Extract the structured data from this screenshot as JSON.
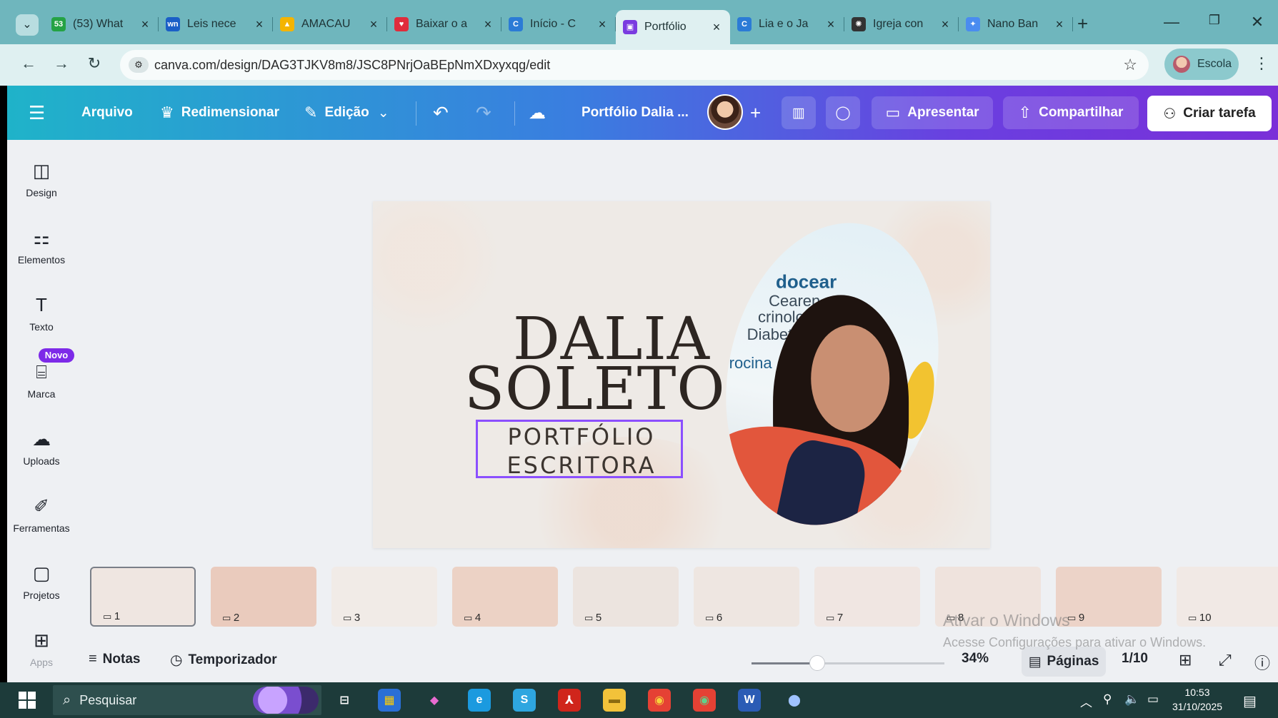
{
  "browser": {
    "tabs": [
      {
        "title": "(53) What",
        "favicon": "whatsapp-icon",
        "favicon_label": "53",
        "color": "#25a244"
      },
      {
        "title": "Leis nece",
        "favicon": "wn-icon",
        "favicon_label": "wn",
        "color": "#1a5fc7"
      },
      {
        "title": "AMACAU",
        "favicon": "google-drive-icon",
        "favicon_label": "▲",
        "color": "#f4b400"
      },
      {
        "title": "Baixar o a",
        "favicon": "heart-icon",
        "favicon_label": "♥",
        "color": "#e02c3c"
      },
      {
        "title": "Início - C",
        "favicon": "canva-icon",
        "favicon_label": "C",
        "color": "#2b7bd6"
      },
      {
        "title": "Portfólio",
        "favicon": "canva-present-icon",
        "favicon_label": "▣",
        "color": "#7a3ce0",
        "active": true
      },
      {
        "title": "Lia e o Ja",
        "favicon": "canva-icon",
        "favicon_label": "C",
        "color": "#2b7bd6"
      },
      {
        "title": "Igreja con",
        "favicon": "openai-icon",
        "favicon_label": "✺",
        "color": "#333333"
      },
      {
        "title": "Nano Ban",
        "favicon": "gemini-icon",
        "favicon_label": "✦",
        "color": "#4a8cf0"
      }
    ],
    "url": "canva.com/design/DAG3TJKV8m8/JSC8PNrjOaBEpNmXDxyxqg/edit",
    "profile_label": "Escola"
  },
  "toolbar": {
    "menu_icon": "hamburger-icon",
    "arquivo": "Arquivo",
    "redimensionar": "Redimensionar",
    "edicao": "Edição",
    "design_title": "Portfólio Dalia ...",
    "apresentar": "Apresentar",
    "compartilhar": "Compartilhar",
    "criar_tarefa": "Criar tarefa"
  },
  "sidebar": {
    "items": [
      {
        "label": "Design",
        "icon": "design-icon"
      },
      {
        "label": "Elementos",
        "icon": "elements-icon"
      },
      {
        "label": "Texto",
        "icon": "text-icon"
      },
      {
        "label": "Marca",
        "icon": "brand-icon",
        "badge": "Novo"
      },
      {
        "label": "Uploads",
        "icon": "upload-icon"
      },
      {
        "label": "Ferramentas",
        "icon": "tools-icon"
      },
      {
        "label": "Projetos",
        "icon": "folder-icon"
      },
      {
        "label": "Apps",
        "icon": "apps-icon"
      }
    ]
  },
  "canvas": {
    "title_line1": "DALIA",
    "title_line2": "SOLETO",
    "subtitle_line1": "PORTFÓLIO",
    "subtitle_line2": "ESCRITORA",
    "photo_text1": "docear",
    "photo_text2": "Cearen",
    "photo_text3": "crinolo",
    "photo_text4": "Diabete",
    "photo_text5": "rocina",
    "accent_color": "#8b4fff"
  },
  "thumbnails": [
    {
      "num": "1",
      "selected": true,
      "bg": "#efe6e1"
    },
    {
      "num": "2",
      "bg": "#eacbbd"
    },
    {
      "num": "3",
      "bg": "#f1ebe7"
    },
    {
      "num": "4",
      "bg": "#ecd2c5"
    },
    {
      "num": "5",
      "bg": "#ece4df"
    },
    {
      "num": "6",
      "bg": "#eee6e1"
    },
    {
      "num": "7",
      "bg": "#f0e6e2"
    },
    {
      "num": "8",
      "bg": "#efe3dd"
    },
    {
      "num": "9",
      "bg": "#ecd3c8"
    },
    {
      "num": "10",
      "bg": "#f1e9e5"
    }
  ],
  "footer": {
    "notas": "Notas",
    "temporizador": "Temporizador",
    "zoom": "34%",
    "zoom_fraction": 0.34,
    "paginas": "Páginas",
    "page_count": "1/10"
  },
  "watermark": {
    "line1": "Ativar o Windows",
    "line2": "Acesse Configurações para ativar o Windows."
  },
  "taskbar": {
    "search": "Pesquisar",
    "time": "10:53",
    "date": "31/10/2025",
    "apps": [
      {
        "icon": "task-view-icon",
        "label": "⊟",
        "bg": "transparent",
        "fg": "#ffffff"
      },
      {
        "icon": "microsoft-store-icon",
        "label": "▦",
        "bg": "#2a6fd6",
        "fg": "#ffcc00"
      },
      {
        "icon": "copilot-icon",
        "label": "◆",
        "bg": "transparent",
        "fg": "#e96bd1"
      },
      {
        "icon": "edge-icon",
        "label": "e",
        "bg": "#1b9adf",
        "fg": "#ffffff"
      },
      {
        "icon": "skype-icon",
        "label": "S",
        "bg": "#2ea6e0",
        "fg": "#ffffff"
      },
      {
        "icon": "acrobat-icon",
        "label": "⅄",
        "bg": "#d0251b",
        "fg": "#ffffff"
      },
      {
        "icon": "file-explorer-icon",
        "label": "▬",
        "bg": "#f2c23a",
        "fg": "#8a6a10"
      },
      {
        "icon": "chrome-icon",
        "label": "◉",
        "bg": "#e54134",
        "fg": "#f7d13b"
      },
      {
        "icon": "chrome-profile-icon",
        "label": "◉",
        "bg": "#e54134",
        "fg": "#5fd18a"
      },
      {
        "icon": "word-icon",
        "label": "W",
        "bg": "#2b5cb5",
        "fg": "#ffffff"
      },
      {
        "icon": "zoom-icon",
        "label": "⬤",
        "bg": "transparent",
        "fg": "#9fc2ff"
      }
    ]
  }
}
